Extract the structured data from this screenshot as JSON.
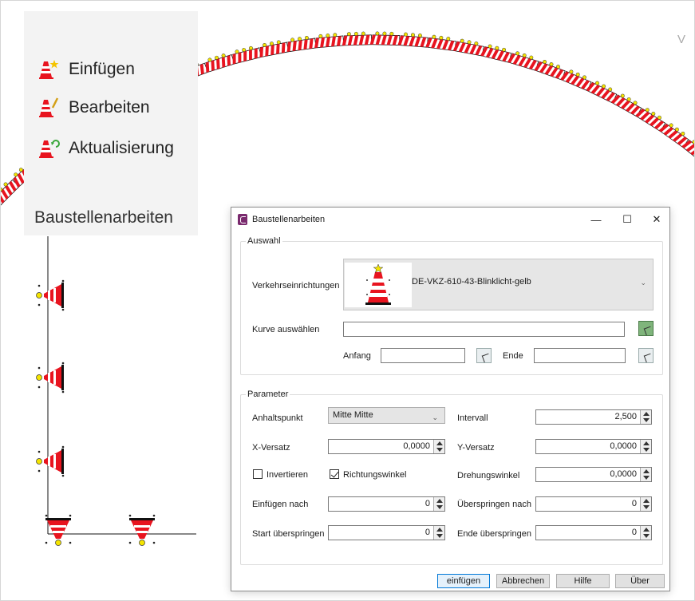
{
  "ribbon": {
    "insert_label": "Einfügen",
    "edit_label": "Bearbeiten",
    "update_label": "Aktualisierung",
    "group_label": "Baustellenarbeiten"
  },
  "canvas": {
    "corner_icon": "V",
    "colors": {
      "cone_red": "#e8141f",
      "cone_white": "#ffffff",
      "light_yellow": "#f4e400"
    }
  },
  "dialog": {
    "title": "Baustellenarbeiten",
    "minimize_icon": "—",
    "maximize_icon": "☐",
    "close_icon": "✕",
    "auswahl": {
      "legend": "Auswahl",
      "device_label": "Verkehrseinrichtungen",
      "device_value": "DE-VKZ-610-43-Blinklicht-gelb",
      "curve_label": "Kurve auswählen",
      "curve_value": "",
      "start_label": "Anfang",
      "start_value": "",
      "end_label": "Ende",
      "end_value": ""
    },
    "parameter": {
      "legend": "Parameter",
      "anchor_label": "Anhaltspunkt",
      "anchor_value": "Mitte Mitte",
      "interval_label": "Intervall",
      "interval_value": "2,500",
      "xoffset_label": "X-Versatz",
      "xoffset_value": "0,0000",
      "yoffset_label": "Y-Versatz",
      "yoffset_value": "0,0000",
      "invert_label": "Invertieren",
      "invert_checked": false,
      "direction_label": "Richtungswinkel",
      "direction_checked": true,
      "rotation_label": "Drehungswinkel",
      "rotation_value": "0,0000",
      "insert_after_label": "Einfügen nach",
      "insert_after_value": "0",
      "skip_after_label": "Überspringen nach",
      "skip_after_value": "0",
      "start_skip_label": "Start überspringen",
      "start_skip_value": "0",
      "end_skip_label": "Ende überspringen",
      "end_skip_value": "0"
    },
    "buttons": {
      "insert": "einfügen",
      "cancel": "Abbrechen",
      "help": "Hilfe",
      "about": "Über"
    }
  }
}
